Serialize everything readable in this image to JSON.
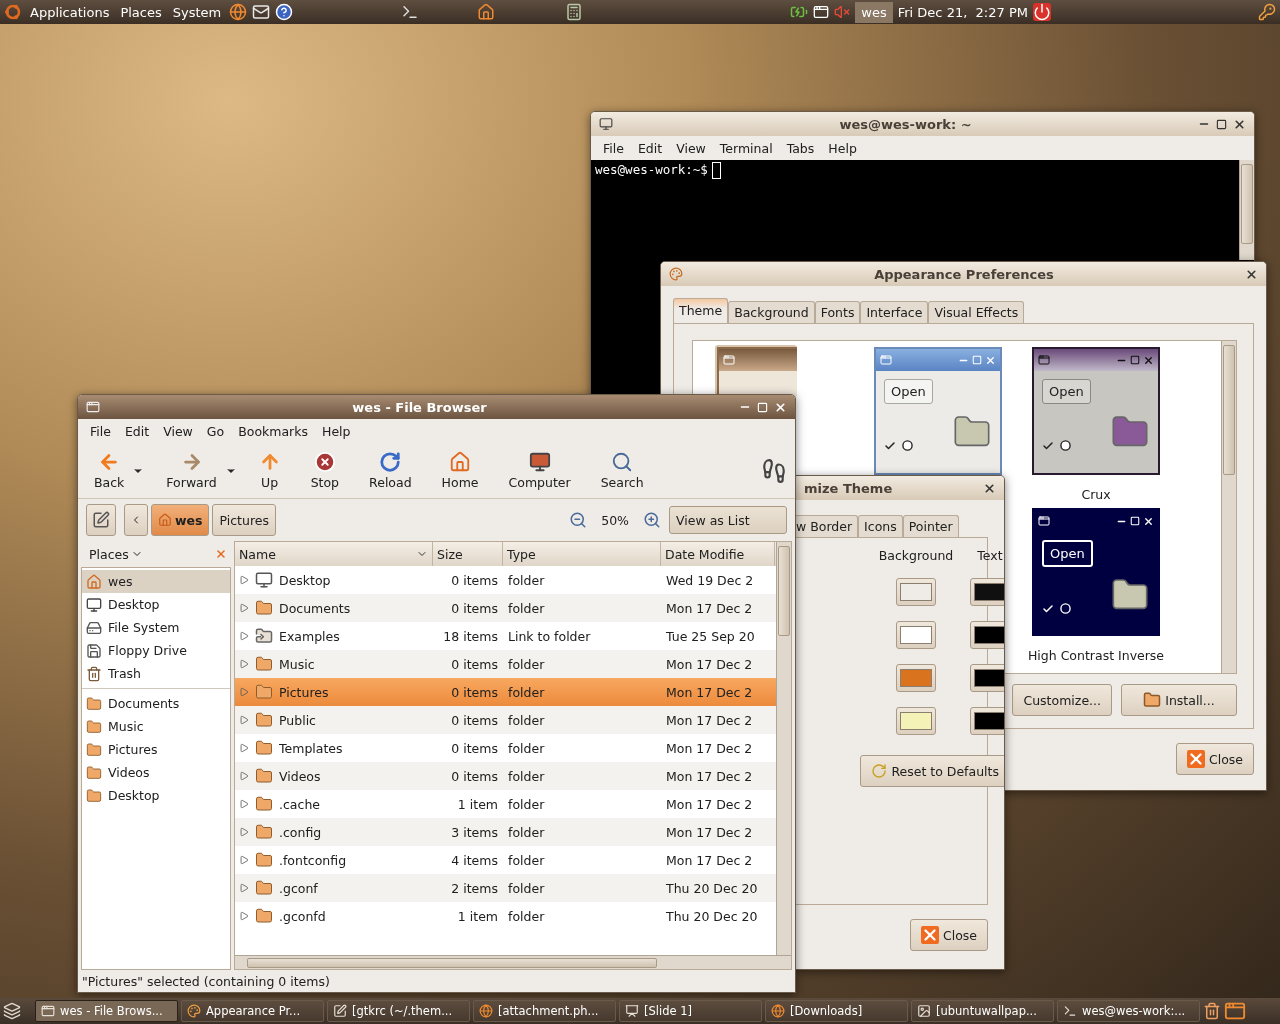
{
  "top_panel": {
    "menus": [
      "Applications",
      "Places",
      "System"
    ],
    "user": "wes",
    "clock": "Fri Dec 21,  2:27 PM"
  },
  "terminal": {
    "title": "wes@wes-work: ~",
    "menus": [
      "File",
      "Edit",
      "View",
      "Terminal",
      "Tabs",
      "Help"
    ],
    "prompt": "wes@wes-work:~$"
  },
  "appearance": {
    "title": "Appearance Preferences",
    "tabs": [
      {
        "label": "Theme",
        "selected": true
      },
      {
        "label": "Background",
        "selected": false
      },
      {
        "label": "Fonts",
        "selected": false
      },
      {
        "label": "Interface",
        "selected": false
      },
      {
        "label": "Visual Effects",
        "selected": false
      }
    ],
    "themes": [
      {
        "kind": "human",
        "selected": true
      },
      {
        "kind": "clearlooks",
        "button": "Open",
        "selected": false
      },
      {
        "kind": "crux",
        "button": "Open",
        "name": "Crux",
        "selected": false
      },
      {
        "kind": "contrast",
        "button": "Open",
        "name": "High Contrast Inverse",
        "selected": false
      }
    ],
    "buttons": [
      "Customize...",
      "Install..."
    ],
    "close": "Close"
  },
  "customize": {
    "title": "mize Theme",
    "tabs": [
      {
        "label": "w Border",
        "selected": false
      },
      {
        "label": "Icons",
        "selected": false
      },
      {
        "label": "Pointer",
        "selected": false
      }
    ],
    "headers": [
      "Background",
      "Text"
    ],
    "reset": "Reset to Defaults",
    "close": "Close"
  },
  "file_browser": {
    "title": "wes - File Browser",
    "menus": [
      "File",
      "Edit",
      "View",
      "Go",
      "Bookmarks",
      "Help"
    ],
    "toolbar": [
      {
        "kind": "back",
        "label": "Back"
      },
      {
        "kind": "forward",
        "label": "Forward"
      },
      {
        "kind": "up",
        "label": "Up"
      },
      {
        "kind": "stop",
        "label": "Stop"
      },
      {
        "kind": "reload",
        "label": "Reload"
      },
      {
        "kind": "home",
        "label": "Home"
      },
      {
        "kind": "computer",
        "label": "Computer"
      },
      {
        "kind": "search",
        "label": "Search"
      }
    ],
    "path": [
      {
        "label": "wes",
        "selected": true
      },
      {
        "label": "Pictures",
        "selected": false
      }
    ],
    "zoom": "50%",
    "view_mode": "View as List",
    "sidebar": {
      "title": "Places",
      "groups": [
        [
          {
            "kind": "home",
            "label": "wes",
            "selected": true
          },
          {
            "kind": "desktop",
            "label": "Desktop",
            "selected": false
          },
          {
            "kind": "drive",
            "label": "File System",
            "selected": false
          },
          {
            "kind": "floppy",
            "label": "Floppy Drive",
            "selected": false
          },
          {
            "kind": "trash",
            "label": "Trash",
            "selected": false
          }
        ],
        [
          {
            "kind": "folder",
            "label": "Documents",
            "selected": false
          },
          {
            "kind": "folder",
            "label": "Music",
            "selected": false
          },
          {
            "kind": "folder",
            "label": "Pictures",
            "selected": false
          },
          {
            "kind": "folder",
            "label": "Videos",
            "selected": false
          },
          {
            "kind": "folder",
            "label": "Desktop",
            "selected": false
          }
        ]
      ]
    },
    "columns": [
      "Name",
      "Size",
      "Type",
      "Date Modifie"
    ],
    "rows": [
      {
        "kind": "desktop",
        "name": "Desktop",
        "size": "0 items",
        "type": "folder",
        "date": "Wed 19 Dec 2",
        "selected": false
      },
      {
        "kind": "folder",
        "name": "Documents",
        "size": "0 items",
        "type": "folder",
        "date": "Mon 17 Dec 2",
        "selected": false
      },
      {
        "kind": "link",
        "name": "Examples",
        "size": "18 items",
        "type": "Link to folder",
        "date": "Tue 25 Sep 20",
        "selected": false
      },
      {
        "kind": "folder",
        "name": "Music",
        "size": "0 items",
        "type": "folder",
        "date": "Mon 17 Dec 2",
        "selected": false
      },
      {
        "kind": "folder",
        "name": "Pictures",
        "size": "0 items",
        "type": "folder",
        "date": "Mon 17 Dec 2",
        "selected": true
      },
      {
        "kind": "folder",
        "name": "Public",
        "size": "0 items",
        "type": "folder",
        "date": "Mon 17 Dec 2",
        "selected": false
      },
      {
        "kind": "folder",
        "name": "Templates",
        "size": "0 items",
        "type": "folder",
        "date": "Mon 17 Dec 2",
        "selected": false
      },
      {
        "kind": "folder",
        "name": "Videos",
        "size": "0 items",
        "type": "folder",
        "date": "Mon 17 Dec 2",
        "selected": false
      },
      {
        "kind": "folder",
        "name": ".cache",
        "size": "1 item",
        "type": "folder",
        "date": "Mon 17 Dec 2",
        "selected": false
      },
      {
        "kind": "folder",
        "name": ".config",
        "size": "3 items",
        "type": "folder",
        "date": "Mon 17 Dec 2",
        "selected": false
      },
      {
        "kind": "folder",
        "name": ".fontconfig",
        "size": "4 items",
        "type": "folder",
        "date": "Mon 17 Dec 2",
        "selected": false
      },
      {
        "kind": "folder",
        "name": ".gconf",
        "size": "2 items",
        "type": "folder",
        "date": "Thu 20 Dec 20",
        "selected": false
      },
      {
        "kind": "folder",
        "name": ".gconfd",
        "size": "1 item",
        "type": "folder",
        "date": "Thu 20 Dec 20",
        "selected": false
      }
    ],
    "status": "\"Pictures\" selected (containing 0 items)"
  },
  "taskbar": [
    {
      "kind": "files",
      "label": "wes - File Brows...",
      "selected": true
    },
    {
      "kind": "appearance",
      "label": "Appearance Pr...",
      "selected": false
    },
    {
      "kind": "editor",
      "label": "[gtkrc (~/.them...",
      "selected": false
    },
    {
      "kind": "browser",
      "label": "[attachment.ph...",
      "selected": false
    },
    {
      "kind": "slides",
      "label": "[Slide 1]",
      "selected": false
    },
    {
      "kind": "browser",
      "label": "[Downloads]",
      "selected": false
    },
    {
      "kind": "image",
      "label": "[ubuntuwallpap...",
      "selected": false
    },
    {
      "kind": "terminal",
      "label": "wes@wes-work:...",
      "selected": false
    }
  ]
}
